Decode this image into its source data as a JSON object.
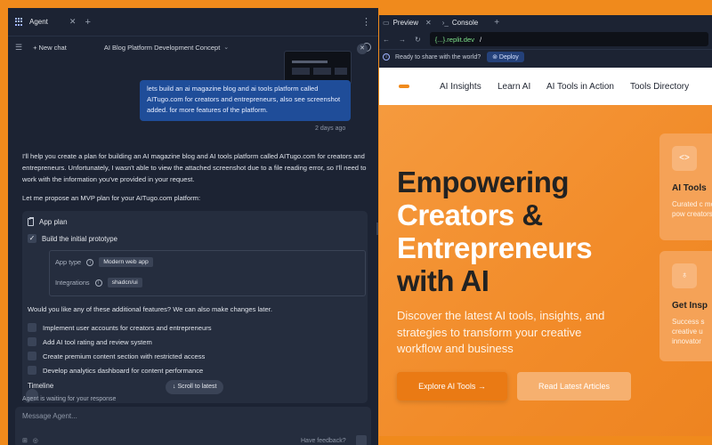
{
  "agent": {
    "tab_title": "Agent",
    "new_chat": "New chat",
    "chat_title": "AI Blog Platform Development Concept",
    "user_message": "lets build an ai magazine blog and ai tools platform called AITugo.com for creators and entrepreneurs, also see screenshot added. for more features of the platform.",
    "message_time": "2 days ago",
    "reply_paragraph": "I'll help you create a plan for building an AI magazine blog and AI tools platform called AITugo.com for creators and entrepreneurs. Unfortunately, I wasn't able to view the attached screenshot due to a file reading error, so I'll need to work with the information you've provided in your request.",
    "reply_propose": "Let me propose an MVP plan for your AITugo.com platform:",
    "plan": {
      "title": "App plan",
      "prototype_label": "Build the initial prototype",
      "app_type_label": "App type",
      "app_type_value": "Modern web app",
      "integrations_label": "Integrations",
      "integrations_value": "shadcn/ui",
      "question": "Would you like any of these additional features? We can also make changes later.",
      "options": [
        "Implement user accounts for creators and entrepreneurs",
        "Add AI tool rating and review system",
        "Create premium content section with restricted access",
        "Develop analytics dashboard for content performance"
      ],
      "timeline_label": "Timeline"
    },
    "scroll_latest": "Scroll to latest",
    "waiting_text": "Agent is waiting for your response",
    "composer_placeholder": "Message Agent...",
    "feedback": "Have feedback?"
  },
  "preview": {
    "tab_preview": "Preview",
    "tab_console": "Console",
    "url_domain": "{...}.replit.dev",
    "url_path": "/",
    "banner_text": "Ready to share with the world?",
    "deploy_label": "Deploy",
    "nav": [
      "AI Insights",
      "Learn AI",
      "AI Tools in Action",
      "Tools Directory"
    ],
    "hero": {
      "line1": "Empowering",
      "line2_orange": "Creators",
      "line2_amp": "&",
      "line3": "Entrepreneurs",
      "line4": "with AI",
      "description": "Discover the latest AI tools, insights, and strategies to transform your creative workflow and business",
      "explore_label": "Explore AI Tools →",
      "read_label": "Read Latest Articles"
    },
    "cards": [
      {
        "title": "AI Tools",
        "desc": "Curated c most pow creators"
      },
      {
        "title": "Get Insp",
        "desc": "Success s creative u innovator"
      }
    ]
  },
  "colors": {
    "frame": "#f08a1c",
    "agent_bg": "#1c2333",
    "user_bubble": "#1f4d99",
    "hero_orange": "#f28c2a"
  }
}
